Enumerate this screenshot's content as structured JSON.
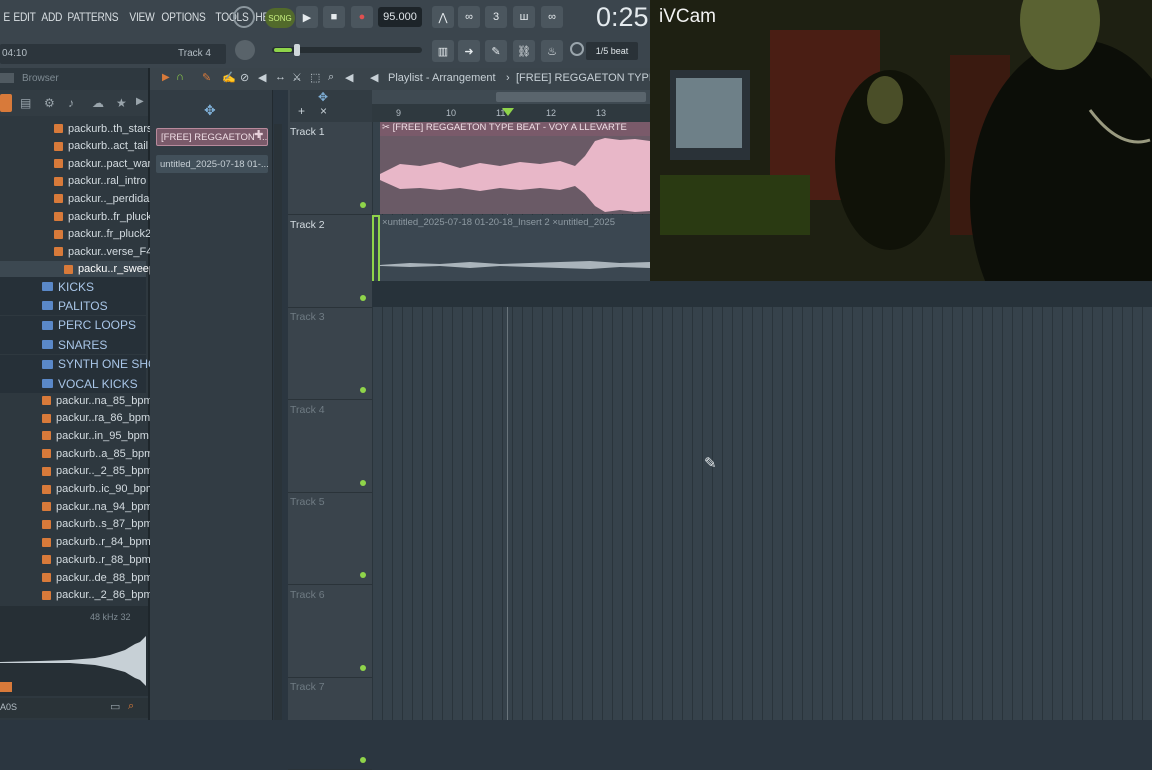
{
  "menu": {
    "items": [
      "E",
      "EDIT",
      "ADD",
      "PATTERNS",
      "VIEW",
      "OPTIONS",
      "TOOLS",
      "HELP"
    ]
  },
  "transport": {
    "mode": "SONG",
    "tempo": "95.000",
    "time": "0:25",
    "snap": "1/5 beat"
  },
  "hint": {
    "left": "04:10",
    "right": "Track 4"
  },
  "browser": {
    "title": "Browser",
    "files_top": [
      "packurb..th_stars",
      "packurb..act_tail",
      "packur..pact_war",
      "packur..ral_intro",
      "packur.._perdida",
      "packurb..fr_pluck",
      "packur..fr_pluck2",
      "packur..verse_F4",
      "packu..r_sweep"
    ],
    "folders": [
      "KICKS",
      "PALITOS",
      "PERC LOOPS",
      "SNARES",
      "SYNTH ONE SHOTS",
      "VOCAL KICKS"
    ],
    "files_bottom": [
      "packur..na_85_bpm",
      "packur..ra_86_bpm",
      "packur..in_95_bpm",
      "packurb..a_85_bpm",
      "packur.._2_85_bpm",
      "packurb..ic_90_bpm",
      "packur..na_94_bpm",
      "packurb..s_87_bpm",
      "packurb..r_84_bpm",
      "packurb..r_88_bpm",
      "packur..de_88_bpm",
      "packur.._2_86_bpm"
    ],
    "sample_info": "48 kHz 32",
    "footer": "A0S"
  },
  "picker": {
    "clips": [
      "[FREE] REGGAETON T..",
      "untitled_2025-07-18 01-..."
    ]
  },
  "playlist": {
    "title": "Playlist - Arrangement",
    "pattern": "[FREE] REGGAETON TYPE",
    "ruler": [
      "9",
      "10",
      "11",
      "12",
      "13"
    ],
    "tracks": [
      "Track 1",
      "Track 2",
      "Track 3",
      "Track 4",
      "Track 5",
      "Track 6",
      "Track 7"
    ],
    "clip1_label": "[FREE] REGGAETON TYPE BEAT - VOY A LLEVARTE",
    "clip2_label": "untitled_2025-07-18 01-20-18_Insert 2",
    "clip3_label": "untitled_2025"
  },
  "webcam": {
    "label": "iVCam"
  },
  "colors": {
    "accent": "#8fd44a",
    "audio_clip": "#e8b7c8",
    "clip_header": "#7a5a6a"
  }
}
